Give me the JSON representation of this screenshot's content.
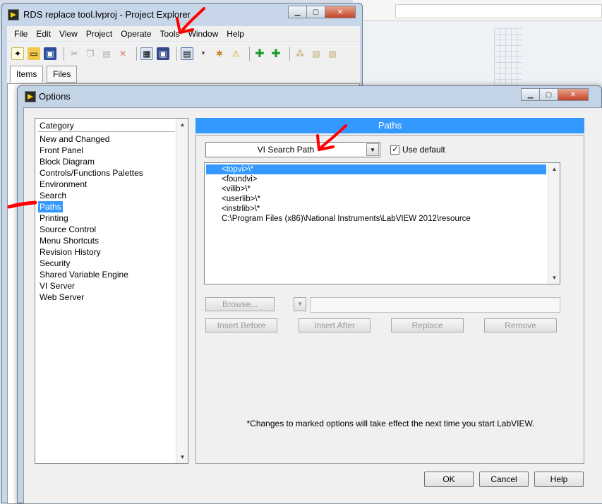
{
  "project_explorer": {
    "title": "RDS replace tool.lvproj - Project Explorer",
    "menu": [
      "File",
      "Edit",
      "View",
      "Project",
      "Operate",
      "Tools",
      "Window",
      "Help"
    ],
    "tabs": [
      "Items",
      "Files"
    ],
    "toolbar_icons": [
      "new-icon",
      "open-icon",
      "save-all-icon",
      "cut-icon",
      "copy-icon",
      "paste-icon",
      "delete-icon",
      "build-icon",
      "save-icon",
      "view-icon",
      "properties-icon",
      "warning-icon",
      "add-icon",
      "add-folder-icon",
      "dependencies-icon",
      "package-icon",
      "deploy-icon"
    ]
  },
  "options_dialog": {
    "title": "Options",
    "category_header": "Category",
    "categories": [
      "New and Changed",
      "Front Panel",
      "Block Diagram",
      "Controls/Functions Palettes",
      "Environment",
      "Search",
      "Paths",
      "Printing",
      "Source Control",
      "Menu Shortcuts",
      "Revision History",
      "Security",
      "Shared Variable Engine",
      "VI Server",
      "Web Server"
    ],
    "selected_category": "Paths",
    "panel_title": "Paths",
    "path_type_selected": "VI Search Path",
    "use_default_label": "Use default",
    "use_default_checked": true,
    "paths": [
      "<topvi>\\*",
      "<foundvi>",
      "<vilib>\\*",
      "<userlib>\\*",
      "<instrlib>\\*",
      "C:\\Program Files (x86)\\National Instruments\\LabVIEW 2012\\resource"
    ],
    "selected_path_index": 0,
    "buttons": {
      "browse": "Browse...",
      "insert_before": "Insert Before",
      "insert_after": "Insert After",
      "replace": "Replace",
      "remove": "Remove",
      "ok": "OK",
      "cancel": "Cancel",
      "help": "Help"
    },
    "note": "*Changes to marked options will take effect the next time you start LabVIEW."
  },
  "colors": {
    "selection": "#3399ff",
    "annotation": "#ff0000"
  }
}
